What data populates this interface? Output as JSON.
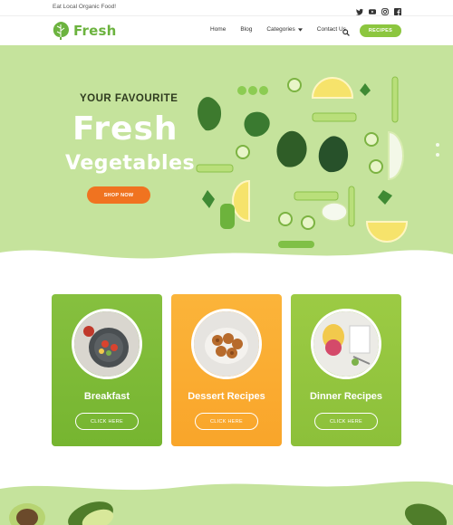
{
  "topbar": {
    "tagline": "Eat Local Organic Food!",
    "social_icons": [
      "twitter-icon",
      "youtube-icon",
      "instagram-icon",
      "facebook-icon"
    ]
  },
  "header": {
    "logo_text": "Fresh",
    "nav": [
      {
        "label": "Home"
      },
      {
        "label": "Blog"
      },
      {
        "label": "Categories",
        "has_dropdown": true
      },
      {
        "label": "Contact Us"
      }
    ],
    "recipes_button": "RECIPES"
  },
  "hero": {
    "subtitle": "YOUR FAVOURITE",
    "title_line1": "Fresh",
    "title_line2": "Vegetables",
    "cta": "SHOP NOW",
    "slider_dots": 2
  },
  "cards": [
    {
      "title": "Breakfast",
      "button": "CLICK HERE",
      "color": "#7cb835"
    },
    {
      "title": "Dessert Recipes",
      "button": "CLICK HERE",
      "color": "#fbb03b"
    },
    {
      "title": "Dinner Recipes",
      "button": "CLICK HERE",
      "color": "#95c63f"
    }
  ],
  "colors": {
    "brand_green": "#6cb33f",
    "hero_bg": "#c5e39c",
    "cta_orange": "#f07320"
  }
}
